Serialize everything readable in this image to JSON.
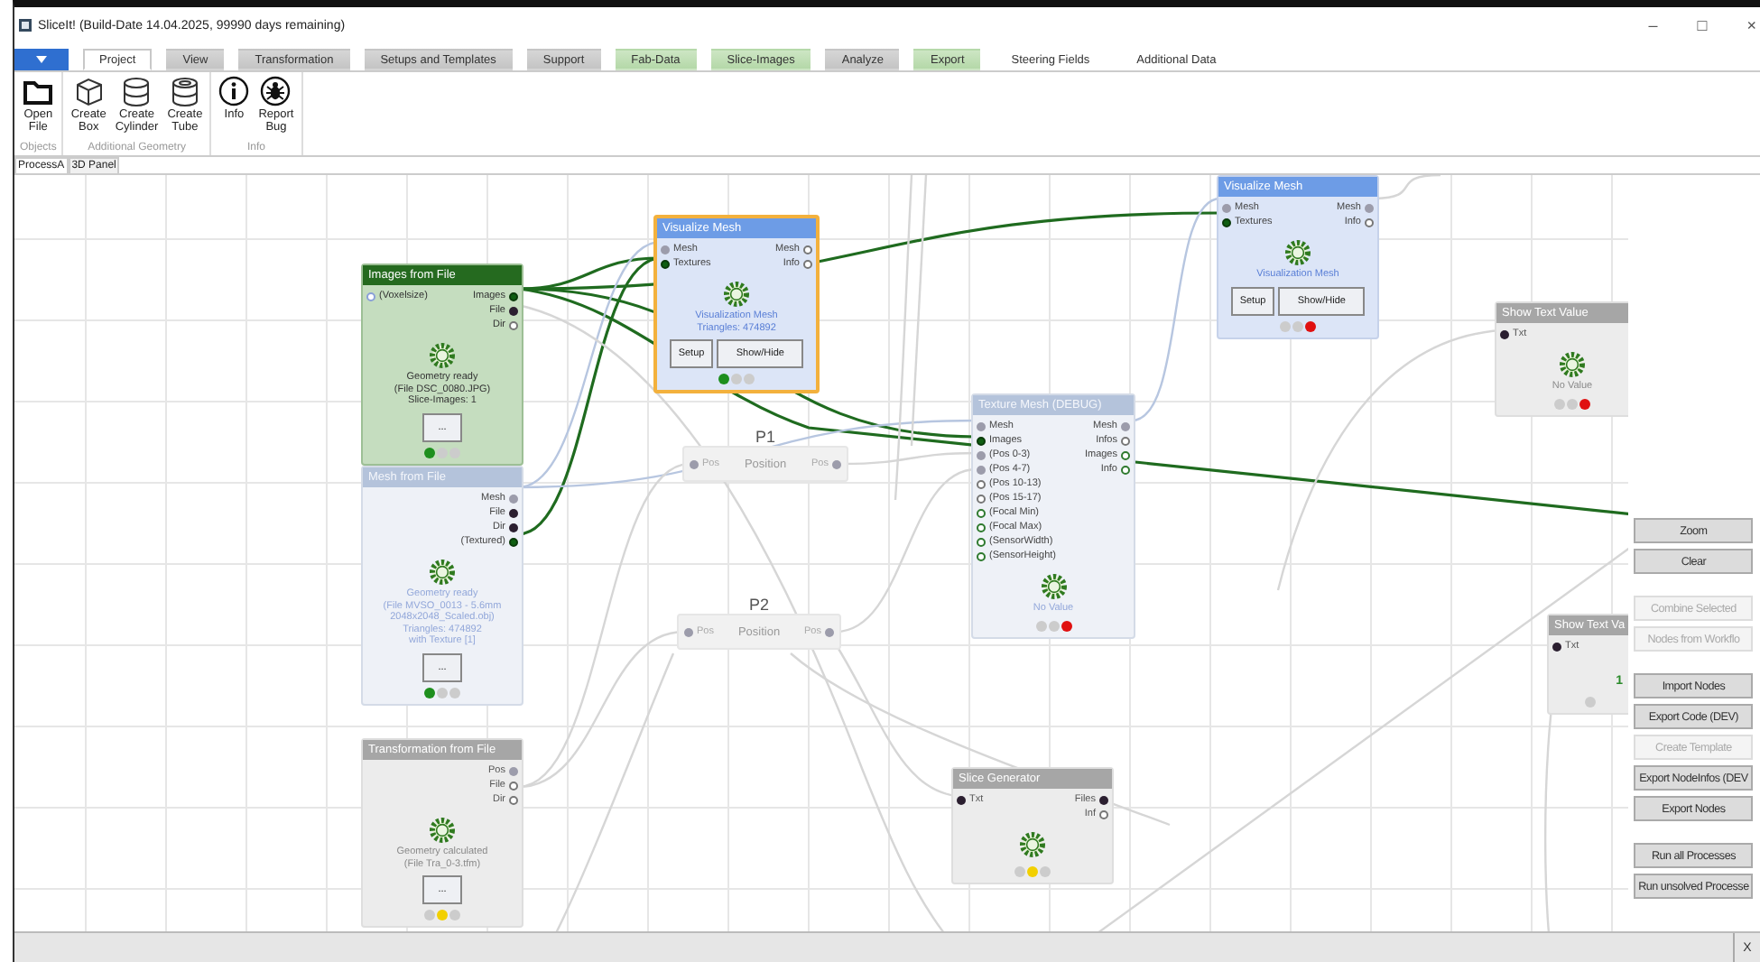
{
  "window": {
    "title": "SliceIt! (Build-Date 14.04.2025, 99990 days remaining)",
    "controls": [
      "–",
      "□",
      "×"
    ]
  },
  "ribbon_tabs": [
    {
      "label": "Project",
      "selected": true,
      "kind": "grey"
    },
    {
      "label": "View",
      "selected": false,
      "kind": "grey"
    },
    {
      "label": "Transformation",
      "selected": false,
      "kind": "grey"
    },
    {
      "label": "Setups and Templates",
      "selected": false,
      "kind": "grey"
    },
    {
      "label": "Support",
      "selected": false,
      "kind": "grey"
    },
    {
      "label": "Fab-Data",
      "selected": false,
      "kind": "green"
    },
    {
      "label": "Slice-Images",
      "selected": false,
      "kind": "green"
    },
    {
      "label": "Analyze",
      "selected": false,
      "kind": "grey"
    },
    {
      "label": "Export",
      "selected": false,
      "kind": "green"
    },
    {
      "label": "Steering Fields",
      "selected": false,
      "kind": "plain"
    },
    {
      "label": "Additional Data",
      "selected": false,
      "kind": "plain"
    }
  ],
  "ribbon_groups": [
    {
      "label": "Objects",
      "items": [
        {
          "label": "Open\nFile"
        }
      ]
    },
    {
      "label": "Additional Geometry",
      "items": [
        {
          "label": "Create\nBox"
        },
        {
          "label": "Create\nCylinder"
        },
        {
          "label": "Create\nTube"
        }
      ]
    },
    {
      "label": "Info",
      "items": [
        {
          "label": "Info"
        },
        {
          "label": "Report\nBug"
        }
      ]
    }
  ],
  "doc_tabs": [
    {
      "label": "ProcessA",
      "selected": true
    },
    {
      "label": "3D Panel",
      "selected": false
    }
  ],
  "nodes": [
    {
      "title": "Images from File",
      "kind": "green",
      "selected": false,
      "inputs": [
        {
          "label": "(Voxelsize)",
          "kind": "optional"
        }
      ],
      "outputs": [
        {
          "label": "Images",
          "kind": "texture"
        },
        {
          "label": "File",
          "kind": "file"
        },
        {
          "label": "Dir",
          "kind": "empty"
        }
      ],
      "status": "Geometry ready\n(File DSC_0080.JPG)\nSlice-Images: 1",
      "buttons": [
        "..."
      ],
      "lights": [
        {
          "color": "#1e8f1e"
        },
        {
          "color": "#cccccc"
        },
        {
          "color": "#cccccc"
        }
      ]
    },
    {
      "title": "Mesh from File",
      "kind": "steel",
      "selected": false,
      "outputs": [
        {
          "label": "Mesh",
          "kind": "mesh"
        },
        {
          "label": "File",
          "kind": "file"
        },
        {
          "label": "Dir",
          "kind": "file"
        },
        {
          "label": "(Textured)",
          "kind": "texture"
        }
      ],
      "status": "Geometry ready\n(File MVSO_0013 - 5.6mm\n2048x2048_Scaled.obj)\nTriangles: 474892\nwith Texture [1]",
      "buttons": [
        "..."
      ],
      "lights": [
        {
          "color": "#1e8f1e"
        },
        {
          "color": "#cccccc"
        },
        {
          "color": "#cccccc"
        }
      ]
    },
    {
      "title": "Visualize Mesh",
      "kind": "blue",
      "selected": true,
      "inputs": [
        {
          "label": "Mesh",
          "kind": "mesh"
        },
        {
          "label": "Textures",
          "kind": "texture"
        }
      ],
      "outputs": [
        {
          "label": "Mesh",
          "kind": "empty"
        },
        {
          "label": "Info",
          "kind": "empty"
        }
      ],
      "status": "Visualization Mesh\nTriangles: 474892",
      "buttons": [
        "Setup",
        "Show/Hide"
      ],
      "lights": [
        {
          "color": "#1e8f1e"
        },
        {
          "color": "#cccccc"
        },
        {
          "color": "#cccccc"
        }
      ]
    },
    {
      "title": "Visualize Mesh",
      "kind": "blue",
      "selected": false,
      "inputs": [
        {
          "label": "Mesh",
          "kind": "mesh"
        },
        {
          "label": "Textures",
          "kind": "texture"
        }
      ],
      "outputs": [
        {
          "label": "Mesh",
          "kind": "mesh"
        },
        {
          "label": "Info",
          "kind": "empty"
        }
      ],
      "status": "Visualization Mesh",
      "buttons": [
        "Setup",
        "Show/Hide"
      ],
      "lights": [
        {
          "color": "#cccccc"
        },
        {
          "color": "#cccccc"
        },
        {
          "color": "#e01010"
        }
      ]
    },
    {
      "title": "Texture Mesh (DEBUG)",
      "kind": "steel",
      "selected": false,
      "inputs": [
        {
          "label": "Mesh",
          "kind": "mesh"
        },
        {
          "label": "Images",
          "kind": "texture"
        },
        {
          "label": "(Pos 0-3)",
          "kind": "mesh"
        },
        {
          "label": "(Pos 4-7)",
          "kind": "mesh"
        },
        {
          "label": "(Pos 10-13)",
          "kind": "empty"
        },
        {
          "label": "(Pos 15-17)",
          "kind": "empty"
        },
        {
          "label": "(Focal Min)",
          "kind": "param"
        },
        {
          "label": "(Focal Max)",
          "kind": "param"
        },
        {
          "label": "(SensorWidth)",
          "kind": "param"
        },
        {
          "label": "(SensorHeight)",
          "kind": "param"
        }
      ],
      "outputs": [
        {
          "label": "Mesh",
          "kind": "mesh"
        },
        {
          "label": "Infos",
          "kind": "empty"
        },
        {
          "label": "Images",
          "kind": "param"
        },
        {
          "label": "Info",
          "kind": "param"
        }
      ],
      "status": "No Value",
      "lights": [
        {
          "color": "#cccccc"
        },
        {
          "color": "#cccccc"
        },
        {
          "color": "#e01010"
        }
      ]
    },
    {
      "title": "P1",
      "kind": "position",
      "selected": false,
      "caption": "Position",
      "inputs": [
        {
          "label": "Pos",
          "kind": "mesh"
        }
      ],
      "outputs": [
        {
          "label": "Pos",
          "kind": "mesh"
        }
      ]
    },
    {
      "title": "P2",
      "kind": "position",
      "selected": false,
      "caption": "Position",
      "inputs": [
        {
          "label": "Pos",
          "kind": "mesh"
        }
      ],
      "outputs": [
        {
          "label": "Pos",
          "kind": "mesh"
        }
      ]
    },
    {
      "title": "Show Text Value",
      "kind": "grey",
      "selected": false,
      "inputs": [
        {
          "label": "Txt",
          "kind": "file"
        }
      ],
      "status": "No Value",
      "lights": [
        {
          "color": "#cccccc"
        },
        {
          "color": "#cccccc"
        },
        {
          "color": "#e01010"
        }
      ]
    },
    {
      "title": "Show Text Va",
      "kind": "grey",
      "selected": false,
      "inputs": [
        {
          "label": "Txt",
          "kind": "file"
        }
      ],
      "value": "1",
      "lights": [
        {
          "color": "#cccccc"
        }
      ]
    },
    {
      "title": "Transformation from File",
      "kind": "grey",
      "selected": false,
      "outputs": [
        {
          "label": "Pos",
          "kind": "mesh"
        },
        {
          "label": "File",
          "kind": "empty"
        },
        {
          "label": "Dir",
          "kind": "empty"
        }
      ],
      "status": "Geometry calculated\n(File Tra_0-3.tfm)",
      "buttons": [
        "..."
      ],
      "lights": [
        {
          "color": "#cccccc"
        },
        {
          "color": "#f2d000"
        },
        {
          "color": "#cccccc"
        }
      ]
    },
    {
      "title": "Slice Generator",
      "kind": "grey",
      "selected": false,
      "inputs": [
        {
          "label": "Txt",
          "kind": "file"
        }
      ],
      "outputs": [
        {
          "label": "Files",
          "kind": "file"
        },
        {
          "label": "Inf",
          "kind": "empty"
        }
      ],
      "lights": [
        {
          "color": "#cccccc"
        },
        {
          "color": "#f2d000"
        },
        {
          "color": "#cccccc"
        }
      ]
    }
  ],
  "side_panel": [
    [
      {
        "label": "Zoom",
        "disabled": false
      },
      {
        "label": "Clear",
        "disabled": false
      }
    ],
    [
      {
        "label": "Combine Selected",
        "disabled": true
      },
      {
        "label": "Nodes from Workflo",
        "disabled": true
      }
    ],
    [
      {
        "label": "Import Nodes",
        "disabled": false
      },
      {
        "label": "Export Code (DEV)",
        "disabled": false
      },
      {
        "label": "Create Template",
        "disabled": true
      },
      {
        "label": "Export NodeInfos (DEV",
        "disabled": false
      },
      {
        "label": "Export Nodes",
        "disabled": false
      }
    ],
    [
      {
        "label": "Run all Processes",
        "disabled": false
      },
      {
        "label": "Run unsolved Processe",
        "disabled": false
      }
    ]
  ],
  "status_bar": {
    "close": "X"
  }
}
